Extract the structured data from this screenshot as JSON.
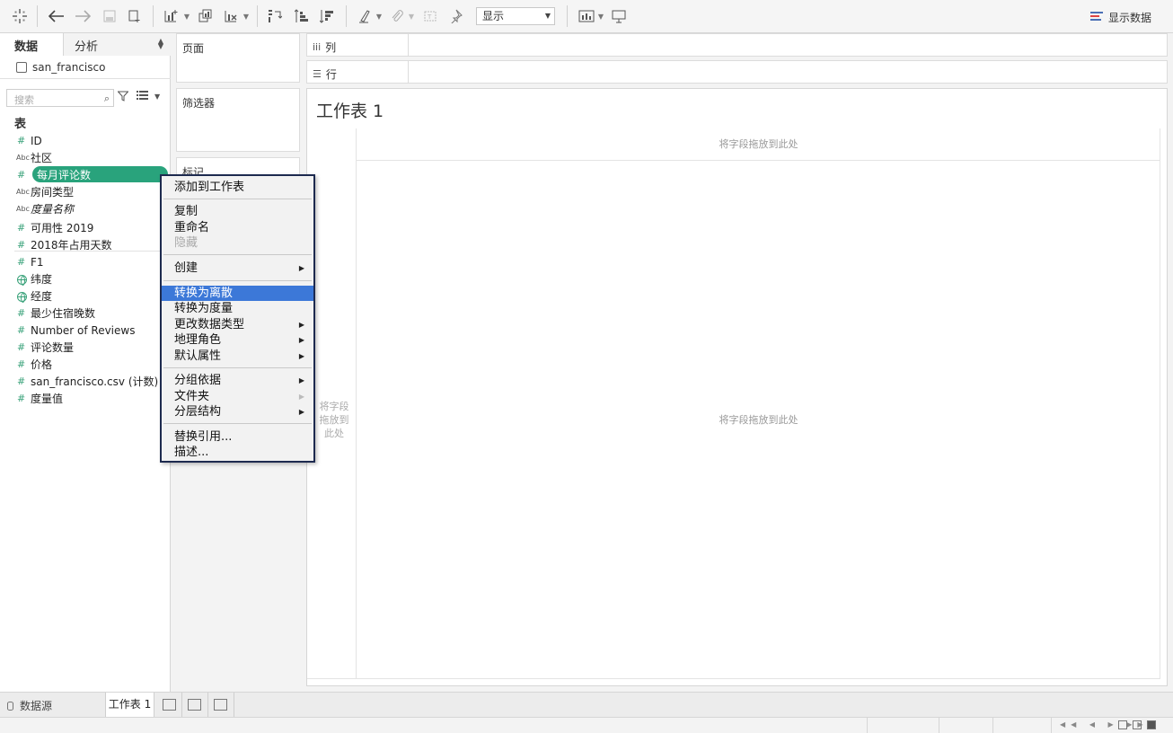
{
  "toolbar": {
    "icons": [
      "tableau-logo-icon",
      "undo-icon",
      "redo-icon",
      "save-icon",
      "new-datasource-icon",
      "new-worksheet-icon",
      "duplicate-sheet-icon",
      "clear-sheet-icon",
      "swap-axes-icon",
      "sort-ascending-icon",
      "sort-descending-icon",
      "highlight-icon",
      "group-icon",
      "labels-icon",
      "pin-icon",
      "chart-type-icon",
      "presentation-icon"
    ],
    "fit_select": "显示",
    "show_me": "显示数据"
  },
  "data_pane": {
    "tab_data": "数据",
    "tab_analysis": "分析",
    "datasource": "san_francisco",
    "search_placeholder": "搜索",
    "section": "表",
    "fields": [
      {
        "type": "#",
        "name": "ID"
      },
      {
        "type": "Abc",
        "name": "社区"
      },
      {
        "type": "#",
        "name": "每月评论数"
      },
      {
        "type": "Abc",
        "name": "房间类型"
      },
      {
        "type": "Abc",
        "name": "度量名称"
      },
      {
        "type": "#",
        "name": "可用性 2019"
      },
      {
        "type": "#",
        "name": "2018年占用天数"
      },
      {
        "type": "#",
        "name": "F1"
      },
      {
        "type": "globe",
        "name": "纬度"
      },
      {
        "type": "globe",
        "name": "经度"
      },
      {
        "type": "#",
        "name": "最少住宿晚数"
      },
      {
        "type": "#",
        "name": "Number of Reviews"
      },
      {
        "type": "#",
        "name": "评论数量"
      },
      {
        "type": "#",
        "name": "价格"
      },
      {
        "type": "#",
        "name": "san_francisco.csv (计数)"
      },
      {
        "type": "#",
        "name": "度量值"
      }
    ]
  },
  "cards": {
    "pages": "页面",
    "filters": "筛选器",
    "marks": "标记"
  },
  "shelves": {
    "columns": "列",
    "rows": "行"
  },
  "canvas": {
    "title": "工作表 1",
    "drop_top": "将字段拖放到此处",
    "drop_left": "将字段拖放到此处",
    "drop_main": "将字段拖放到此处"
  },
  "context_menu": {
    "items": [
      "添加到工作表",
      "复制",
      "重命名",
      "隐藏",
      "创建",
      "转换为离散",
      "转换为度量",
      "更改数据类型",
      "地理角色",
      "默认属性",
      "分组依据",
      "文件夹",
      "分层结构",
      "替换引用...",
      "描述..."
    ]
  },
  "bottom": {
    "datasource_tab": "数据源",
    "sheet_tab": "工作表 1"
  }
}
